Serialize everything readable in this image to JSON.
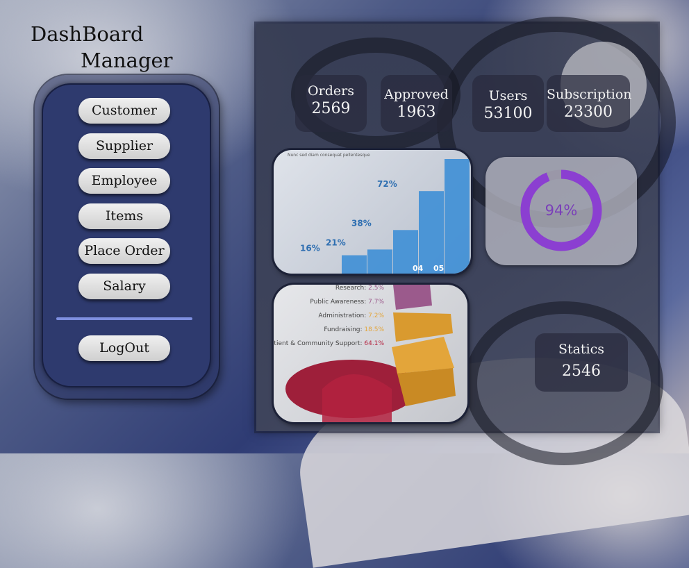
{
  "brand": {
    "line1": "DashBoard",
    "line2": "Manager"
  },
  "nav": {
    "customer": "Customer",
    "supplier": "Supplier",
    "employee": "Employee",
    "items": "Items",
    "place_order": "Place Order",
    "salary": "Salary",
    "logout": "LogOut"
  },
  "stats": {
    "orders": {
      "label": "Orders",
      "value": "2569"
    },
    "approved": {
      "label": "Approved",
      "value": "1963"
    },
    "users": {
      "label": "Users",
      "value": "53100"
    },
    "subscription": {
      "label": "Subscription",
      "value": "23300"
    },
    "statics": {
      "label": "Statics",
      "value": "2546"
    }
  },
  "donut": {
    "percent": 94,
    "text": "94%",
    "ring_color": "#8b3fd1",
    "track_color": "#9a97a8"
  },
  "bar_chart": {
    "caption": "Nunc sed diam consequat pellentesque",
    "labels": [
      "16%",
      "21%",
      "38%",
      "72%"
    ],
    "values": [
      16,
      21,
      38,
      72,
      100
    ],
    "bottom_labels": [
      "04",
      "05"
    ],
    "color": "#3e8fd6"
  },
  "pie_chart": {
    "items": [
      {
        "name": "Research:",
        "value": "2.5%",
        "color": "#9b5a8c"
      },
      {
        "name": "Public Awareness:",
        "value": "7.7%",
        "color": "#9b5a8c"
      },
      {
        "name": "Administration:",
        "value": "7.2%",
        "color": "#e3a53a"
      },
      {
        "name": "Fundraising:",
        "value": "18.5%",
        "color": "#e3a53a"
      },
      {
        "name": "Patient & Community Support:",
        "value": "64.1%",
        "color": "#b3223f"
      }
    ]
  }
}
